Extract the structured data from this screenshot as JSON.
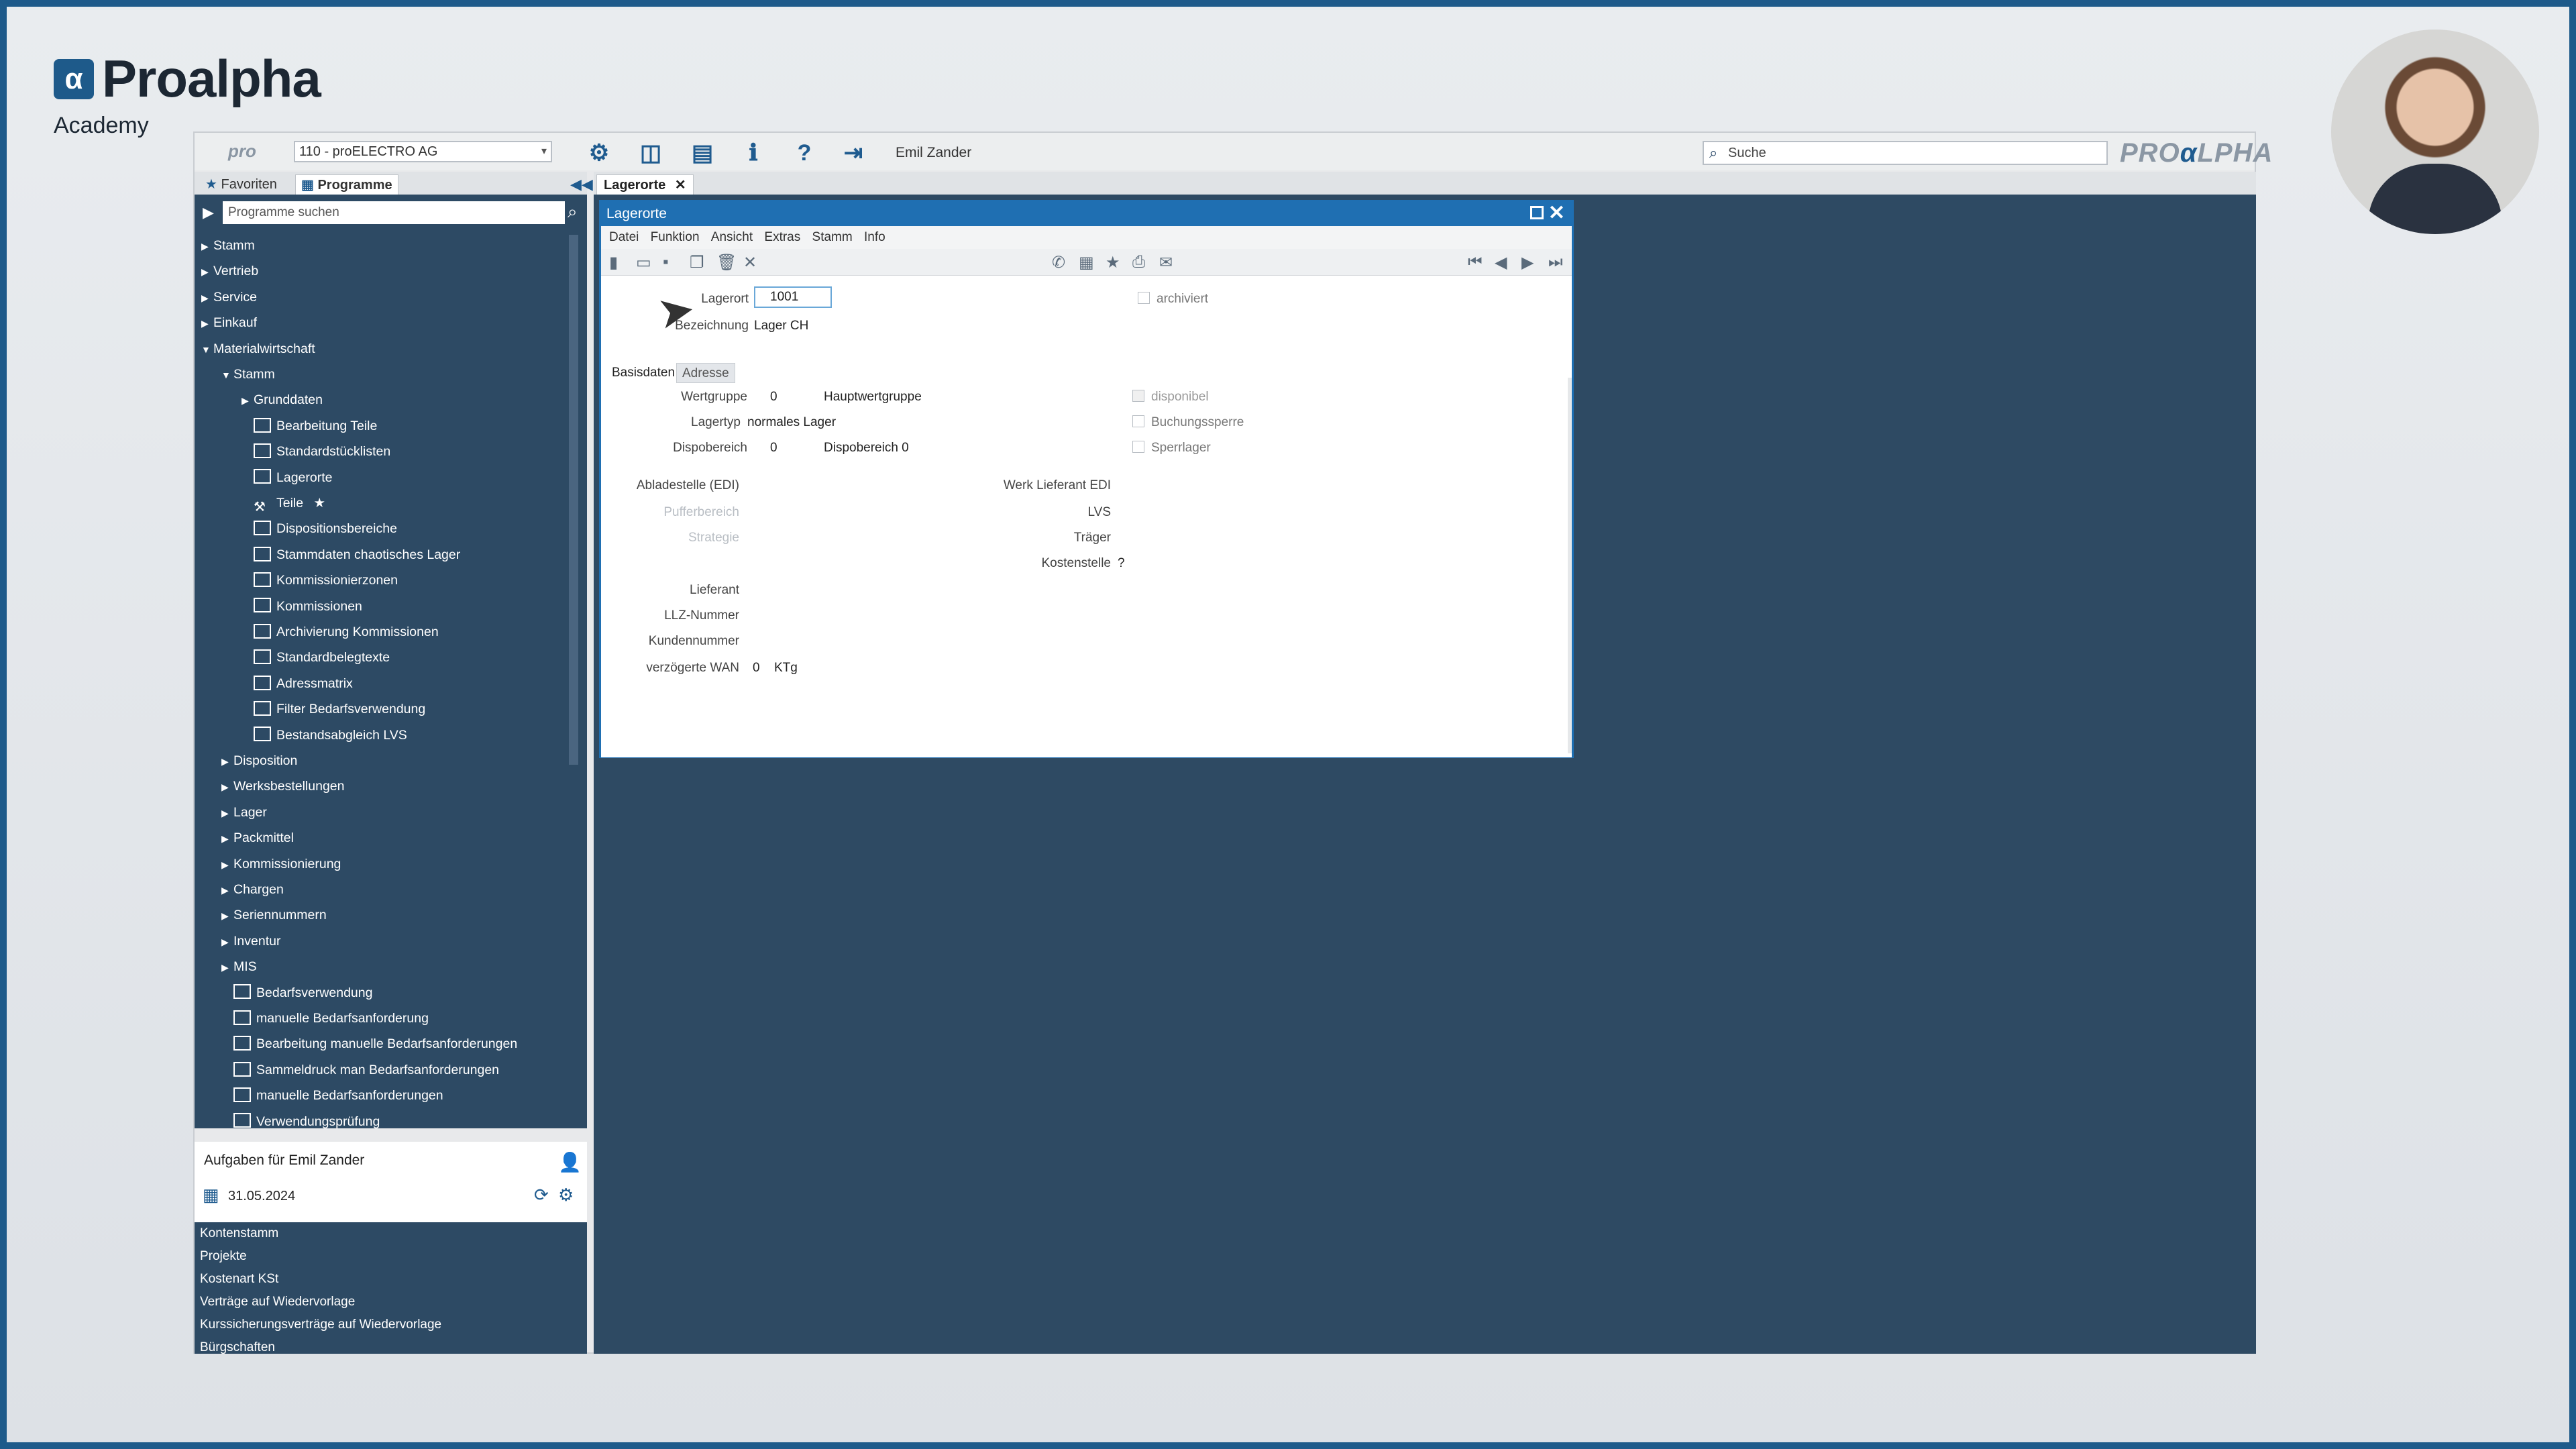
{
  "overlay": {
    "brand_name": "Proalpha",
    "brand_icon": "α",
    "subtitle": "Academy"
  },
  "topbar": {
    "pro_logo": "pro",
    "mandant": "110 - proELECTRO AG",
    "user": "Emil Zander",
    "search_placeholder": "Suche",
    "brand_left": "PRO",
    "brand_mid": "α",
    "brand_right": "LPHA"
  },
  "side_tabs": {
    "favorites": "Favoriten",
    "programs": "Programme"
  },
  "sidebar": {
    "search_placeholder": "Programme suchen",
    "tree": [
      "Stamm",
      "Vertrieb",
      "Service",
      "Einkauf",
      "Materialwirtschaft",
      "Stamm",
      "Grunddaten",
      "Bearbeitung Teile",
      "Standardstücklisten",
      "Lagerorte",
      "Teile",
      "Dispositionsbereiche",
      "Stammdaten chaotisches Lager",
      "Kommissionierzonen",
      "Kommissionen",
      "Archivierung Kommissionen",
      "Standardbelegtexte",
      "Adressmatrix",
      "Filter Bedarfsverwendung",
      "Bestandsabgleich LVS",
      "Disposition",
      "Werksbestellungen",
      "Lager",
      "Packmittel",
      "Kommissionierung",
      "Chargen",
      "Seriennummern",
      "Inventur",
      "MIS",
      "Bedarfsverwendung",
      "manuelle Bedarfsanforderung",
      "Bearbeitung manuelle Bedarfsanforderungen",
      "Sammeldruck man Bedarfsanforderungen",
      "manuelle Bedarfsanforderungen",
      "Verwendungsprüfung"
    ]
  },
  "tasks": {
    "title": "Aufgaben für Emil Zander",
    "date": "31.05.2024",
    "items": [
      "Kontenstamm",
      "Projekte",
      "Kostenart KSt",
      "Verträge auf Wiedervorlage",
      "Kurssicherungsverträge auf Wiedervorlage",
      "Bürgschaften"
    ]
  },
  "main_tab": {
    "label": "Lagerorte",
    "close": "✕"
  },
  "window": {
    "title": "Lagerorte",
    "menu": [
      "Datei",
      "Funktion",
      "Ansicht",
      "Extras",
      "Stamm",
      "Info"
    ]
  },
  "form": {
    "lagerort_label": "Lagerort",
    "lagerort_value": "1001",
    "bezeichnung_label": "Bezeichnung",
    "bezeichnung_value": "Lager CH",
    "archiviert_label": "archiviert",
    "tab_basisdaten": "Basisdaten",
    "tab_adresse": "Adresse",
    "wertgruppe_label": "Wertgruppe",
    "wertgruppe_value": "0",
    "wertgruppe_desc": "Hauptwertgruppe",
    "lagertyp_label": "Lagertyp",
    "lagertyp_value": "normales Lager",
    "dispobereich_label": "Dispobereich",
    "dispobereich_value": "0",
    "dispobereich_desc": "Dispobereich 0",
    "disponibel_label": "disponibel",
    "buchungssperre_label": "Buchungssperre",
    "sperrlager_label": "Sperrlager",
    "abladestelle_label": "Abladestelle (EDI)",
    "pufferbereich_label": "Pufferbereich",
    "strategie_label": "Strategie",
    "werk_lieferant_label": "Werk Lieferant EDI",
    "lvs_label": "LVS",
    "traeger_label": "Träger",
    "kostenstelle_label": "Kostenstelle",
    "kostenstelle_value": "?",
    "lieferant_label": "Lieferant",
    "llz_label": "LLZ-Nummer",
    "kundennummer_label": "Kundennummer",
    "wan_label": "verzögerte WAN",
    "wan_value": "0",
    "wan_unit": "KTg"
  }
}
